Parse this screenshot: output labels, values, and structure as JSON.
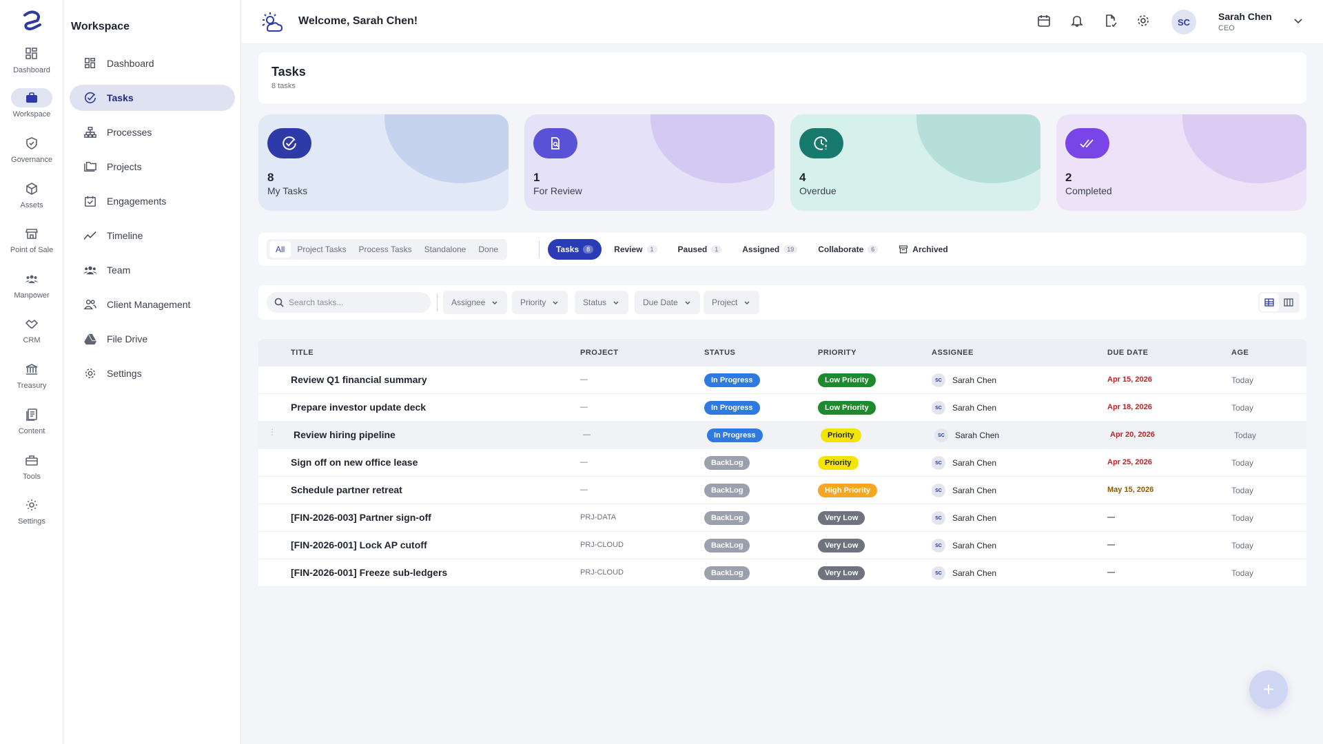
{
  "rail": {
    "items": [
      {
        "label": "Dashboard",
        "icon": "dashboard-grid-icon"
      },
      {
        "label": "Workspace",
        "icon": "briefcase-icon"
      },
      {
        "label": "Governance",
        "icon": "shield-check-icon"
      },
      {
        "label": "Assets",
        "icon": "cube-icon"
      },
      {
        "label": "Point of Sale",
        "icon": "storefront-icon"
      },
      {
        "label": "Manpower",
        "icon": "people-group-icon"
      },
      {
        "label": "CRM",
        "icon": "handshake-icon"
      },
      {
        "label": "Treasury",
        "icon": "bank-icon"
      },
      {
        "label": "Content",
        "icon": "document-icon"
      },
      {
        "label": "Tools",
        "icon": "toolbox-icon"
      },
      {
        "label": "Settings",
        "icon": "gear-icon"
      }
    ]
  },
  "sidebar": {
    "title": "Workspace",
    "items": [
      {
        "label": "Dashboard",
        "icon": "dashboard-grid-icon"
      },
      {
        "label": "Tasks",
        "icon": "check-circle-icon"
      },
      {
        "label": "Processes",
        "icon": "hierarchy-icon"
      },
      {
        "label": "Projects",
        "icon": "folders-icon"
      },
      {
        "label": "Engagements",
        "icon": "calendar-check-icon"
      },
      {
        "label": "Timeline",
        "icon": "trend-line-icon"
      },
      {
        "label": "Team",
        "icon": "team-icon"
      },
      {
        "label": "Client Management",
        "icon": "client-users-icon"
      },
      {
        "label": "File Drive",
        "icon": "drive-icon"
      },
      {
        "label": "Settings",
        "icon": "gear-icon"
      }
    ]
  },
  "header": {
    "welcome": "Welcome, Sarah Chen!",
    "user_initials": "SC",
    "user_name": "Sarah Chen",
    "user_role": "CEO"
  },
  "page": {
    "title": "Tasks",
    "subtitle": "8 tasks"
  },
  "stats": [
    {
      "value": "8",
      "label": "My Tasks",
      "icon": "check-circle-icon",
      "bg": "#e1e9f6",
      "blob": "#c5d3ef",
      "icon_bg": "#2e3aa8"
    },
    {
      "value": "1",
      "label": "For Review",
      "icon": "document-search-icon",
      "bg": "#e5e1f6",
      "blob": "#d3c9f2",
      "icon_bg": "#5a52d6"
    },
    {
      "value": "4",
      "label": "Overdue",
      "icon": "clock-alert-icon",
      "bg": "#d6f0ec",
      "blob": "#b5dfd8",
      "icon_bg": "#177a6c"
    },
    {
      "value": "2",
      "label": "Completed",
      "icon": "double-check-icon",
      "bg": "#eee2f8",
      "blob": "#dccbf2",
      "icon_bg": "#7a45e6"
    }
  ],
  "scope_tabs": [
    "All",
    "Project Tasks",
    "Process Tasks",
    "Standalone",
    "Done"
  ],
  "status_tabs": [
    {
      "label": "Tasks",
      "count": "8"
    },
    {
      "label": "Review",
      "count": "1"
    },
    {
      "label": "Paused",
      "count": "1"
    },
    {
      "label": "Assigned",
      "count": "19"
    },
    {
      "label": "Collaborate",
      "count": "6"
    },
    {
      "label": "Archived",
      "count": ""
    }
  ],
  "filters": {
    "search_placeholder": "Search tasks...",
    "buttons": [
      "Assignee",
      "Priority",
      "Status",
      "Due Date",
      "Project"
    ]
  },
  "table": {
    "columns": [
      "TITLE",
      "PROJECT",
      "STATUS",
      "PRIORITY",
      "ASSIGNEE",
      "DUE DATE",
      "AGE"
    ],
    "rows": [
      {
        "title": "Review Q1 financial summary",
        "project": "—",
        "status": "In Progress",
        "priority": "Low Priority",
        "assignee": "Sarah Chen",
        "initials": "SC",
        "due": "Apr 15, 2026",
        "age": "Today"
      },
      {
        "title": "Prepare investor update deck",
        "project": "—",
        "status": "In Progress",
        "priority": "Low Priority",
        "assignee": "Sarah Chen",
        "initials": "SC",
        "due": "Apr 18, 2026",
        "age": "Today"
      },
      {
        "title": "Review hiring pipeline",
        "project": "—",
        "status": "In Progress",
        "priority": "Priority",
        "assignee": "Sarah Chen",
        "initials": "SC",
        "due": "Apr 20, 2026",
        "age": "Today"
      },
      {
        "title": "Sign off on new office lease",
        "project": "—",
        "status": "BackLog",
        "priority": "Priority",
        "assignee": "Sarah Chen",
        "initials": "SC",
        "due": "Apr 25, 2026",
        "age": "Today"
      },
      {
        "title": "Schedule partner retreat",
        "project": "—",
        "status": "BackLog",
        "priority": "High Priority",
        "assignee": "Sarah Chen",
        "initials": "SC",
        "due": "May 15, 2026",
        "age": "Today"
      },
      {
        "title": "[FIN-2026-003] Partner sign-off",
        "project": "PRJ-DATA",
        "status": "BackLog",
        "priority": "Very Low",
        "assignee": "Sarah Chen",
        "initials": "SC",
        "due": "—",
        "age": "Today"
      },
      {
        "title": "[FIN-2026-001] Lock AP cutoff",
        "project": "PRJ-CLOUD",
        "status": "BackLog",
        "priority": "Very Low",
        "assignee": "Sarah Chen",
        "initials": "SC",
        "due": "—",
        "age": "Today"
      },
      {
        "title": "[FIN-2026-001] Freeze sub-ledgers",
        "project": "PRJ-CLOUD",
        "status": "BackLog",
        "priority": "Very Low",
        "assignee": "Sarah Chen",
        "initials": "SC",
        "due": "—",
        "age": "Today"
      }
    ]
  },
  "fab_label": "+",
  "colors": {
    "accent": "#2a3bb8",
    "status_in_progress": "#2f7ae0",
    "status_backlog": "#9aa0ad",
    "priority_low": "#1e8a2e",
    "priority_normal": "#f5e400",
    "priority_high": "#f5a623",
    "priority_very_low": "#6e737d",
    "due_overdue": "#c0202a",
    "due_upcoming": "#8a5a00"
  }
}
